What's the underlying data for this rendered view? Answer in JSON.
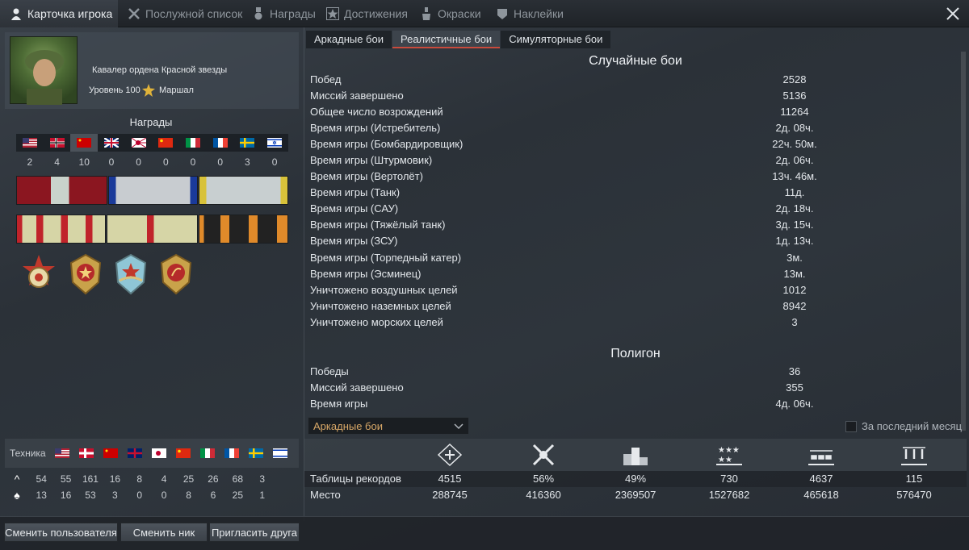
{
  "tabs": [
    {
      "label": "Карточка игрока",
      "icon": "player-card-icon",
      "active": true
    },
    {
      "label": "Послужной список",
      "icon": "service-record-icon"
    },
    {
      "label": "Награды",
      "icon": "award-medal-icon"
    },
    {
      "label": "Достижения",
      "icon": "achievement-star-icon"
    },
    {
      "label": "Окраски",
      "icon": "paint-can-icon"
    },
    {
      "label": "Наклейки",
      "icon": "decal-icon"
    }
  ],
  "profile": {
    "title": "Кавалер ордена Красной звезды",
    "level": "Уровень 100",
    "rank": "Маршал"
  },
  "awards": {
    "label": "Награды",
    "counts": [
      "2",
      "4",
      "10",
      "0",
      "0",
      "0",
      "0",
      "0",
      "3",
      "0"
    ]
  },
  "technique": {
    "label": "Техника",
    "row1": [
      "54",
      "55",
      "161",
      "16",
      "8",
      "4",
      "25",
      "26",
      "68",
      "3"
    ],
    "row2": [
      "13",
      "16",
      "53",
      "3",
      "0",
      "0",
      "8",
      "6",
      "25",
      "1"
    ]
  },
  "mode_tabs": [
    "Аркадные бои",
    "Реалистичные бои",
    "Симуляторные бои"
  ],
  "random_battles": {
    "title": "Случайные бои",
    "rows": [
      {
        "label": "Побед",
        "value": "2528"
      },
      {
        "label": "Миссий завершено",
        "value": "5136"
      },
      {
        "label": "Общее число возрождений",
        "value": "11264"
      },
      {
        "label": "Время игры (Истребитель)",
        "value": "2д. 08ч."
      },
      {
        "label": "Время игры (Бомбардировщик)",
        "value": "22ч. 50м."
      },
      {
        "label": "Время игры (Штурмовик)",
        "value": "2д. 06ч."
      },
      {
        "label": "Время игры (Вертолёт)",
        "value": "13ч. 46м."
      },
      {
        "label": "Время игры (Танк)",
        "value": "11д."
      },
      {
        "label": "Время игры (САУ)",
        "value": "2д. 18ч."
      },
      {
        "label": "Время игры (Тяжёлый танк)",
        "value": "3д. 15ч."
      },
      {
        "label": "Время игры (ЗСУ)",
        "value": "1д. 13ч."
      },
      {
        "label": "Время игры (Торпедный катер)",
        "value": "3м."
      },
      {
        "label": "Время игры (Эсминец)",
        "value": "13м."
      },
      {
        "label": "Уничтожено воздушных целей",
        "value": "1012"
      },
      {
        "label": "Уничтожено наземных целей",
        "value": "8942"
      },
      {
        "label": "Уничтожено морских целей",
        "value": "3"
      }
    ]
  },
  "polygon": {
    "title": "Полигон",
    "rows": [
      {
        "label": "Победы",
        "value": "36"
      },
      {
        "label": "Миссий завершено",
        "value": "355"
      },
      {
        "label": "Время игры",
        "value": "4д. 06ч."
      }
    ]
  },
  "leaderboard": {
    "dropdown": "Аркадные бои",
    "checkbox_label": "За последний месяц",
    "icons": [
      "crossed-planes-icon",
      "crossed-swords-icon",
      "podium-icon",
      "stars-icon",
      "tanks-row-icon",
      "bombs-icon"
    ],
    "row1_label": "Таблицы рекордов",
    "row1": [
      "4515",
      "56%",
      "49%",
      "730",
      "4637",
      "115"
    ],
    "row2_label": "Место",
    "row2": [
      "288745",
      "416360",
      "2369507",
      "1527682",
      "465618",
      "576470"
    ]
  },
  "buttons": {
    "change_user": "Сменить пользователя",
    "change_nick": "Сменить ник",
    "invite_friend": "Пригласить друга"
  }
}
